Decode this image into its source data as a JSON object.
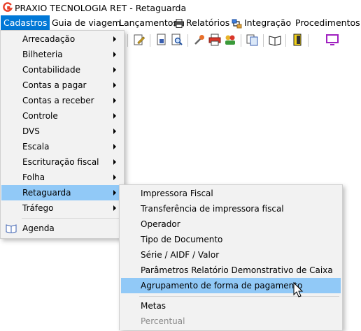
{
  "window": {
    "title": "PRAXIO TECNOLOGIA  RET - Retaguarda"
  },
  "menubar": {
    "items": [
      {
        "label": "Cadastros"
      },
      {
        "label": "Guia de viagem"
      },
      {
        "label": "Lançamentos"
      },
      {
        "label": "Relatórios",
        "icon": "printer-icon"
      },
      {
        "label": "Integração",
        "icon": "integration-icon"
      },
      {
        "label": "Procedimentos A"
      }
    ]
  },
  "cadastros_menu": {
    "items": [
      {
        "label": "Arrecadação",
        "submenu": true
      },
      {
        "label": "Bilheteria",
        "submenu": true
      },
      {
        "label": "Contabilidade",
        "submenu": true
      },
      {
        "label": "Contas a pagar",
        "submenu": true
      },
      {
        "label": "Contas a receber",
        "submenu": true
      },
      {
        "label": "Controle",
        "submenu": true
      },
      {
        "label": "DVS",
        "submenu": true
      },
      {
        "label": "Escala",
        "submenu": true
      },
      {
        "label": "Escrituração fiscal",
        "submenu": true
      },
      {
        "label": "Folha",
        "submenu": true
      },
      {
        "label": "Retaguarda",
        "submenu": true,
        "highlighted": true
      },
      {
        "label": "Tráfego",
        "submenu": true
      },
      {
        "label": "Agenda",
        "icon": "book-icon"
      }
    ]
  },
  "retaguarda_submenu": {
    "items": [
      {
        "label": "Impressora Fiscal"
      },
      {
        "label": "Transferência de impressora fiscal"
      },
      {
        "label": "Operador"
      },
      {
        "label": "Tipo de Documento"
      },
      {
        "label": "Série / AIDF / Valor"
      },
      {
        "label": "Parâmetros Relatório Demonstrativo de Caixa"
      },
      {
        "label": "Agrupamento de forma de pagamento",
        "highlighted": true
      },
      {
        "label": "Metas"
      },
      {
        "label": "Percentual",
        "disabled": true
      }
    ]
  },
  "colors": {
    "menu_active": "#0078d7",
    "highlight": "#91c9f7",
    "menu_bg": "#f2f2f2",
    "disabled_text": "#8a8a8a"
  }
}
